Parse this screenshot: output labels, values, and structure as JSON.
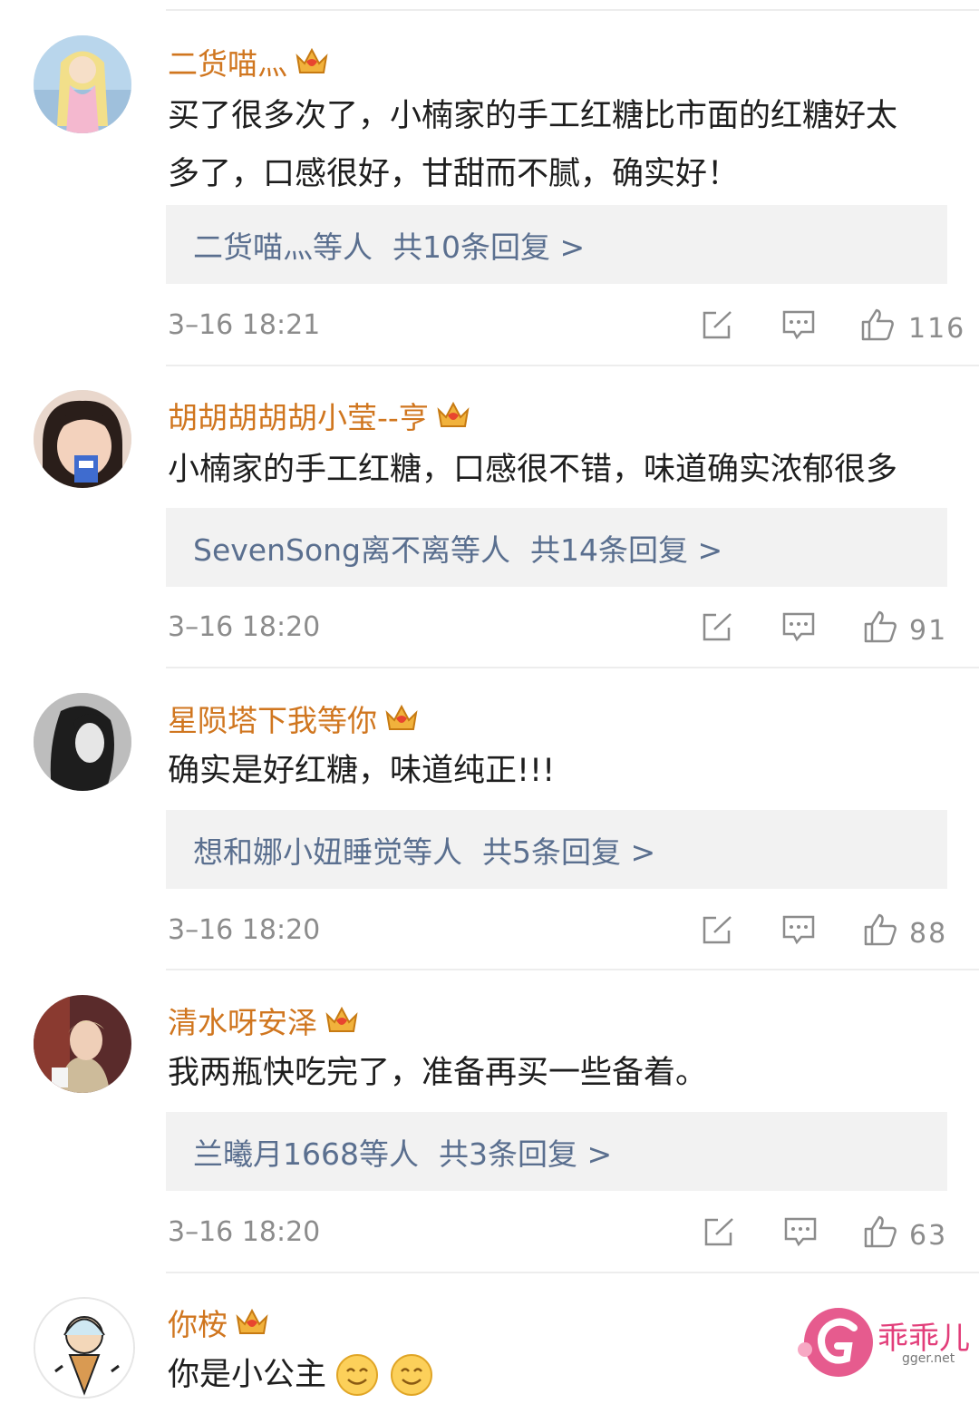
{
  "comments": [
    {
      "username": "二货喵灬",
      "lines": [
        "买了很多次了，小楠家的手工红糖比市面的红糖好太",
        "多了，口感很好，甘甜而不腻，确实好！"
      ],
      "reply_user": "二货喵灬等人",
      "reply_count": "共10条回复 >",
      "time": "3–16 18:21",
      "likes": "116"
    },
    {
      "username": "胡胡胡胡胡小莹--亨",
      "lines": [
        "小楠家的手工红糖，口感很不错，味道确实浓郁很多"
      ],
      "reply_user": "SevenSong离不离等人",
      "reply_count": "共14条回复 >",
      "time": "3–16 18:20",
      "likes": "91"
    },
    {
      "username": "星陨塔下我等你",
      "lines": [
        "确实是好红糖，味道纯正!!!"
      ],
      "reply_user": "想和娜小妞睡觉等人",
      "reply_count": "共5条回复 >",
      "time": "3–16 18:20",
      "likes": "88"
    },
    {
      "username": "清水呀安泽",
      "lines": [
        "我两瓶快吃完了，准备再买一些备着。"
      ],
      "reply_user": "兰曦月1668等人",
      "reply_count": "共3条回复 >",
      "time": "3–16 18:20",
      "likes": "63"
    },
    {
      "username": "你桉",
      "lines": [
        "你是小公主"
      ]
    }
  ],
  "watermark": {
    "text": "乖乖儿",
    "url": "gger.net"
  },
  "colors": {
    "username": "#d0761f",
    "reply_link": "#5a6f8f",
    "meta": "#8c8c8c",
    "watermark": "#e23e7a"
  }
}
